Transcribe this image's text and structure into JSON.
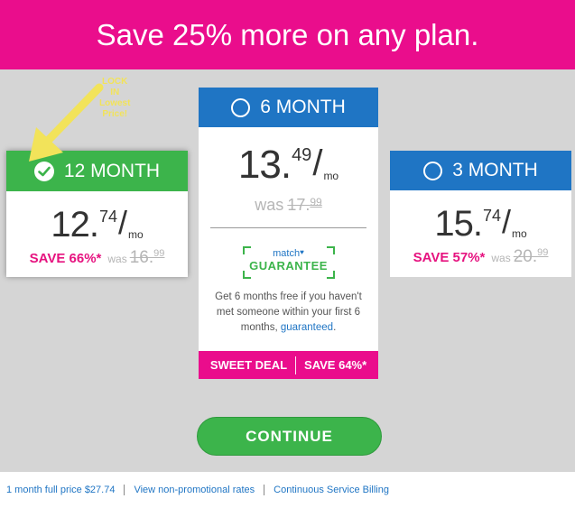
{
  "banner": {
    "text": "Save 25% more on any plan."
  },
  "annotation": {
    "line1": "LOCK",
    "line2": "IN",
    "line3": "Lowest",
    "line4": "Price!"
  },
  "plans": {
    "twelve": {
      "label": "12 MONTH",
      "whole": "12.",
      "cents": "74",
      "slash": "/",
      "mo": "mo",
      "save": "SAVE 66%*",
      "was_label": "was",
      "was_whole": "16.",
      "was_cents": "99",
      "selected": true
    },
    "six": {
      "label": "6 MONTH",
      "whole": "13.",
      "cents": "49",
      "slash": "/",
      "mo": "mo",
      "was_label": "was",
      "was_whole": "17.",
      "was_cents": "99",
      "guarantee_brand": "match",
      "guarantee_word": "GUARANTEE",
      "desc_text": "Get 6 months free if you haven't met someone within your first 6 months,",
      "desc_link": "guaranteed",
      "desc_end": ".",
      "deal_left": "SWEET DEAL",
      "deal_right": "SAVE 64%*",
      "selected": false
    },
    "three": {
      "label": "3 MONTH",
      "whole": "15.",
      "cents": "74",
      "slash": "/",
      "mo": "mo",
      "save": "SAVE 57%*",
      "was_label": "was",
      "was_whole": "20.",
      "was_cents": "99",
      "selected": false
    }
  },
  "continue_label": "CONTINUE",
  "footer": {
    "links": [
      "1 month full price $27.74",
      "View non-promotional rates",
      "Continuous Service Billing"
    ]
  },
  "colors": {
    "magenta": "#ea0d8c",
    "green": "#3cb44b",
    "blue": "#1f75c4",
    "arrow_yellow": "#f2e35a"
  },
  "icons": {
    "selected": "check-circle-icon",
    "unselected": "radio-icon",
    "annotation": "arrow-icon"
  }
}
